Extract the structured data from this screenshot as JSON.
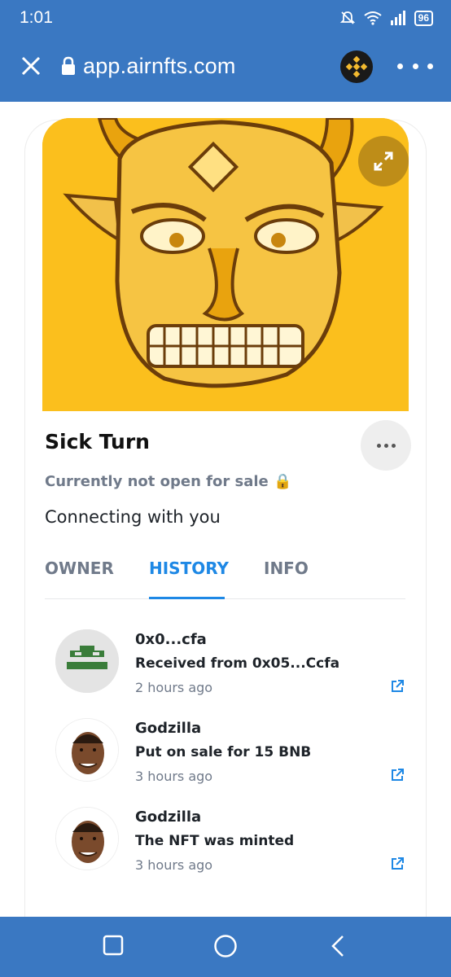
{
  "status_bar": {
    "time": "1:01",
    "battery": "96"
  },
  "browser": {
    "url": "app.airnfts.com"
  },
  "nft": {
    "title": "Sick Turn",
    "sale_status": "Currently not open for sale 🔒",
    "subtitle": "Connecting with you"
  },
  "tabs": [
    {
      "label": "OWNER",
      "active": false
    },
    {
      "label": "HISTORY",
      "active": true
    },
    {
      "label": "INFO",
      "active": false
    }
  ],
  "history": [
    {
      "name": "0x0...cfa",
      "action": "Received from 0x05...Ccfa",
      "time": "2 hours ago",
      "avatar": "pixel-avatar"
    },
    {
      "name": "Godzilla",
      "action": "Put on sale for 15 BNB",
      "time": "3 hours ago",
      "avatar": "face-avatar"
    },
    {
      "name": "Godzilla",
      "action": "The NFT was minted",
      "time": "3 hours ago",
      "avatar": "face-avatar"
    }
  ],
  "colors": {
    "chrome": "#3a78c2",
    "accent": "#1e88e5",
    "art_bg": "#fbbf1d"
  }
}
